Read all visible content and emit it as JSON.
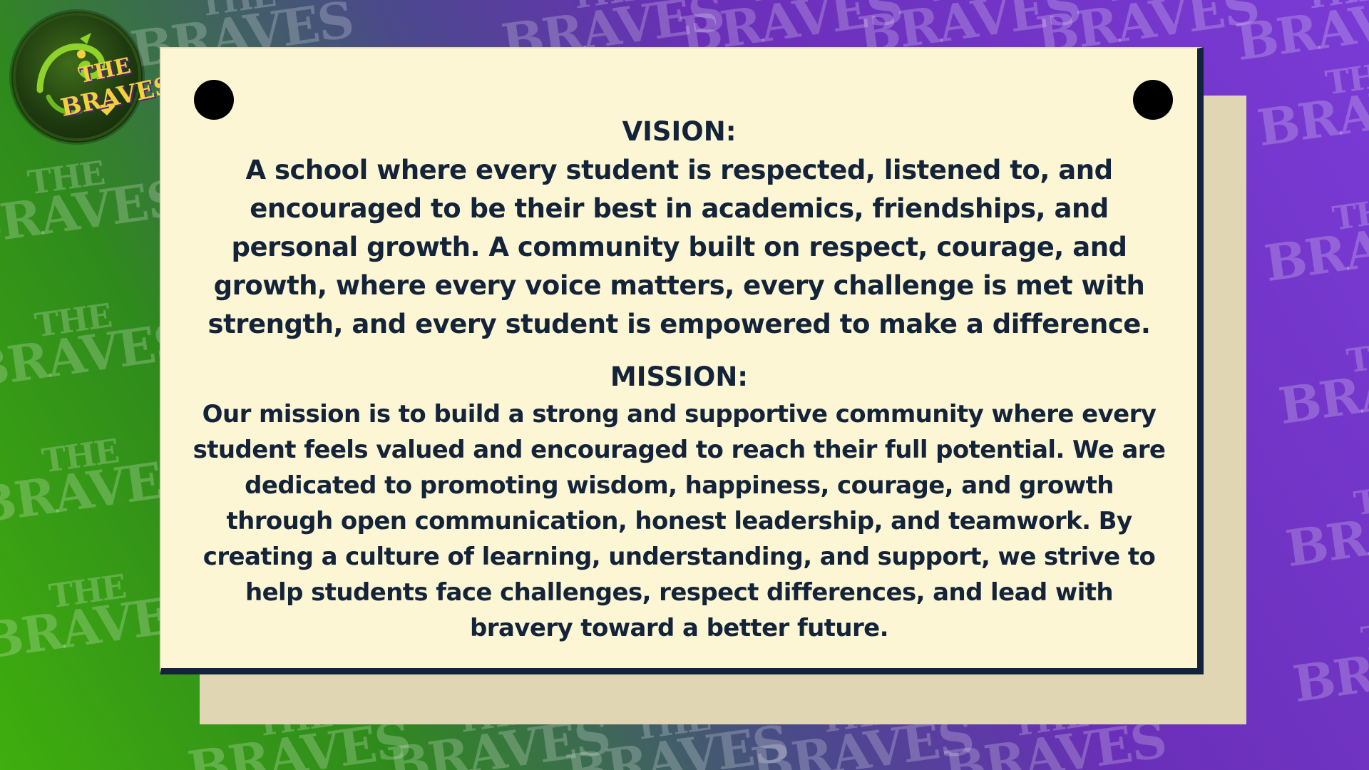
{
  "background": {
    "watermark": {
      "line1": "THE",
      "line2": "BRAVES"
    },
    "colors": {
      "green": "#3fae0e",
      "purple": "#7a3bd6"
    }
  },
  "logo": {
    "line1": "THE",
    "line2": "BRAVES",
    "icon": "chameleon-icon"
  },
  "card": {
    "colors": {
      "paper": "#fdf6d4",
      "shadow": "#e1d6b3",
      "border": "#13243a",
      "text": "#13243a"
    },
    "pins": [
      "pin-icon",
      "pin-icon"
    ],
    "vision": {
      "heading": "VISION:",
      "lines": [
        "A school where every student is respected, listened to, and",
        "encouraged to be their best in academics, friendships, and",
        "personal growth. A community built on respect, courage, and",
        "growth, where every voice matters, every challenge is met with",
        "strength, and every student is empowered to make a difference."
      ]
    },
    "mission": {
      "heading": "MISSION:",
      "lines": [
        "Our mission is to build a strong and supportive community where every",
        "student feels valued and encouraged to reach their full potential. We are",
        "dedicated to promoting wisdom, happiness, courage, and growth",
        "through open communication, honest leadership, and teamwork. By",
        "creating a culture of learning, understanding, and support, we strive to",
        "help students face challenges, respect differences, and lead with",
        "bravery toward a better future."
      ]
    }
  }
}
